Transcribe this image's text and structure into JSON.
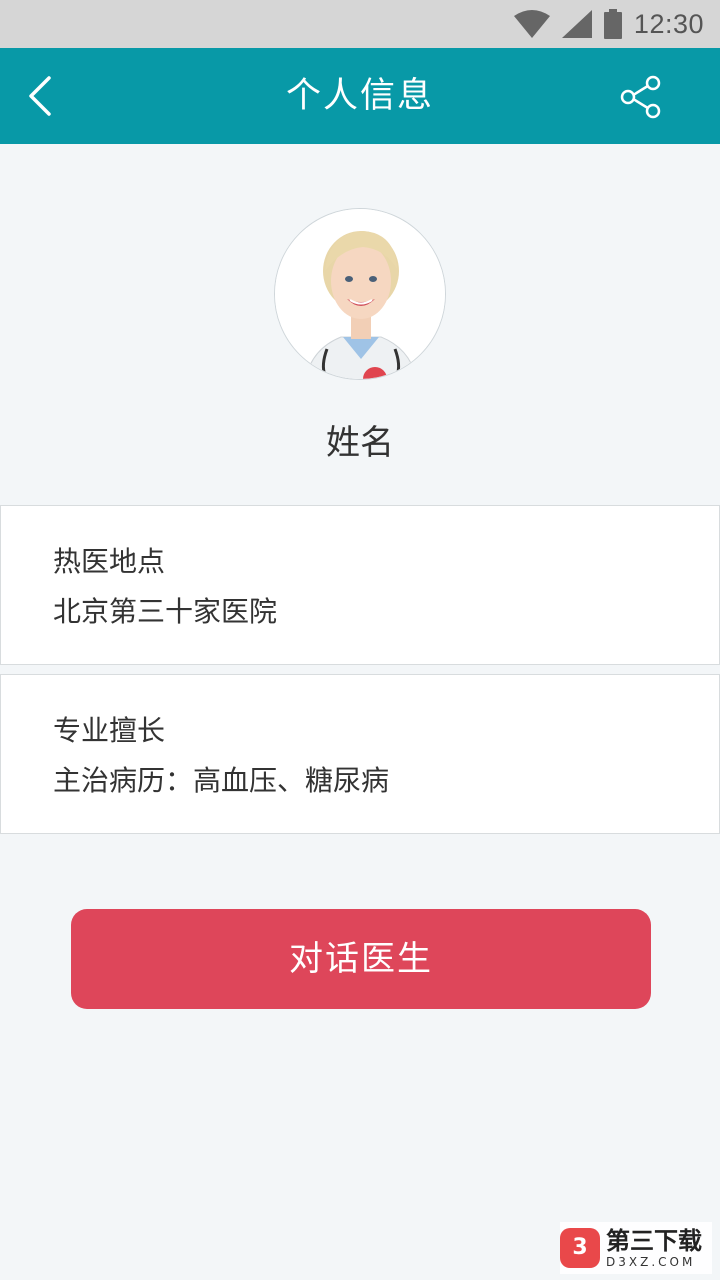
{
  "status_bar": {
    "time": "12:30"
  },
  "header": {
    "title": "个人信息"
  },
  "profile": {
    "name": "姓名"
  },
  "location_card": {
    "label": "热医地点",
    "value": "北京第三十家医院"
  },
  "specialty_card": {
    "label": "专业擅长",
    "value": "主治病历：高血压、糖尿病"
  },
  "actions": {
    "chat_label": "对话医生"
  },
  "watermark": {
    "logo_glyph": "3",
    "title": "第三下载",
    "subtitle": "D3XZ.COM"
  },
  "colors": {
    "header_bg": "#0899a7",
    "button_bg": "#de465a",
    "page_bg": "#f3f6f8"
  }
}
